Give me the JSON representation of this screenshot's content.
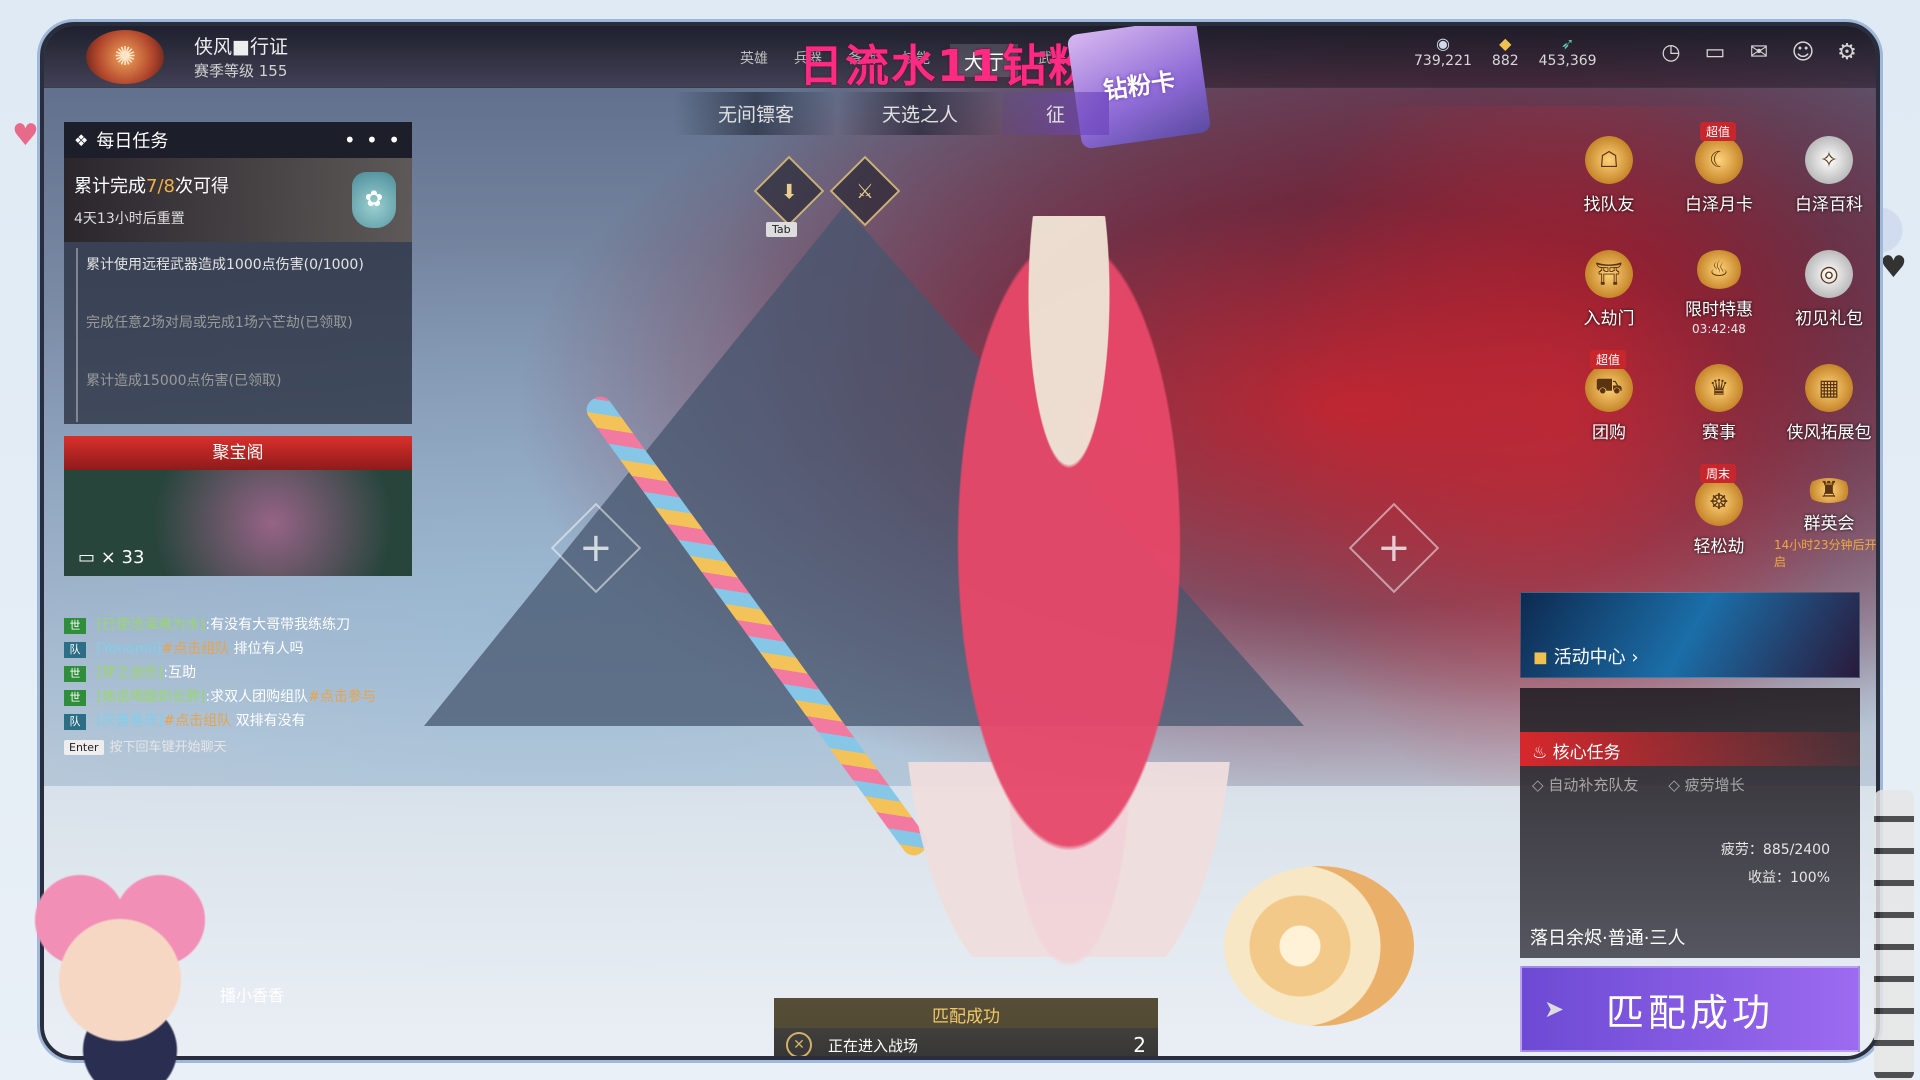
{
  "topbar": {
    "pass_title": "侠风■行证",
    "season_level": "赛季等级 155",
    "nav_tabs": [
      "英雄",
      "兵器",
      "备战",
      "技能",
      "大厅",
      "武器",
      "活动"
    ],
    "active_nav": "大厅",
    "banner_text": "日流水11钻粉",
    "diamond_card": "钻粉卡",
    "currencies": [
      {
        "icon": "coin-icon",
        "value": "739,221"
      },
      {
        "icon": "gold-ingot-icon",
        "value": "882"
      },
      {
        "icon": "feather-icon",
        "value": "453,369"
      }
    ],
    "system_icons": [
      "history-icon",
      "book-icon",
      "mail-icon",
      "friends-icon",
      "settings-icon"
    ]
  },
  "mode_tabs": [
    "无间镖客",
    "天选之人",
    "征"
  ],
  "mode_icons": {
    "tab_key": "Tab"
  },
  "daily": {
    "title": "每日任务",
    "more": "• • •",
    "progress_prefix": "累计完成",
    "progress_value": "7/8",
    "progress_suffix": "次可得",
    "reset": "4天13小时后重置",
    "tasks": [
      {
        "text": "累计使用远程武器造成1000点伤害(0/1000)",
        "done": false
      },
      {
        "text": "完成任意2场对局或完成1场六芒劫(已领取)",
        "done": true
      },
      {
        "text": "累计造成15000点伤害(已领取)",
        "done": true
      }
    ]
  },
  "treasure": {
    "title": "聚宝阁",
    "count": "× 33"
  },
  "chat": {
    "lines": [
      {
        "channel": "世",
        "user": "[已使沧海难为水]",
        "text": ":有没有大哥带我练练刀"
      },
      {
        "channel": "队",
        "user": "[Yonomii]",
        "link": "#点击组队",
        "text": " 排位有人吗"
      },
      {
        "channel": "世",
        "user": "[梦之迪伤]",
        "text": ":互助"
      },
      {
        "channel": "世",
        "user": "[她说喝酸奶长胖]",
        "text": ":求双人团购组队",
        "link": "#点击参与"
      },
      {
        "channel": "队",
        "user": "[庆喜喜庆]",
        "link": "#点击组队",
        "text": " 双排有没有"
      }
    ],
    "enter_key": "Enter",
    "hint": "按下回车键开始聊天"
  },
  "activities": [
    {
      "label": "找队友",
      "icon": "team-up-icon"
    },
    {
      "label": "白泽月卡",
      "icon": "monthly-card-icon",
      "badge": "超值"
    },
    {
      "label": "白泽百科",
      "icon": "encyclopedia-icon"
    },
    {
      "label": "入劫门",
      "icon": "gate-icon"
    },
    {
      "label": "限时特惠",
      "icon": "limited-offer-icon",
      "sub": "03:42:48"
    },
    {
      "label": "初见礼包",
      "icon": "gift-pack-icon"
    },
    {
      "label": "团购",
      "icon": "group-buy-icon",
      "badge": "超值"
    },
    {
      "label": "赛事",
      "icon": "trophy-icon"
    },
    {
      "label": "侠风拓展包",
      "icon": "expansion-pack-icon"
    },
    {
      "label": "",
      "icon": ""
    },
    {
      "label": "轻松劫",
      "icon": "easy-mode-icon",
      "badge": "周末"
    },
    {
      "label": "群英会",
      "icon": "heroes-meet-icon",
      "sub": "14小时23分钟后开启",
      "sub_orange": true
    }
  ],
  "event_center": {
    "label": "活动中心 ›"
  },
  "core_mission": {
    "title": "核心任务",
    "options": [
      "自动补充队友",
      "疲劳增长"
    ],
    "fatigue": "疲劳：885/2400",
    "gain": "收益：100%",
    "map": "落日余烬·普通·三人"
  },
  "match_button": {
    "label": "匹配成功"
  },
  "match_status": {
    "title": "匹配成功",
    "text": "正在进入战场",
    "count": "2"
  },
  "streamer": {
    "name": "播小香香"
  }
}
